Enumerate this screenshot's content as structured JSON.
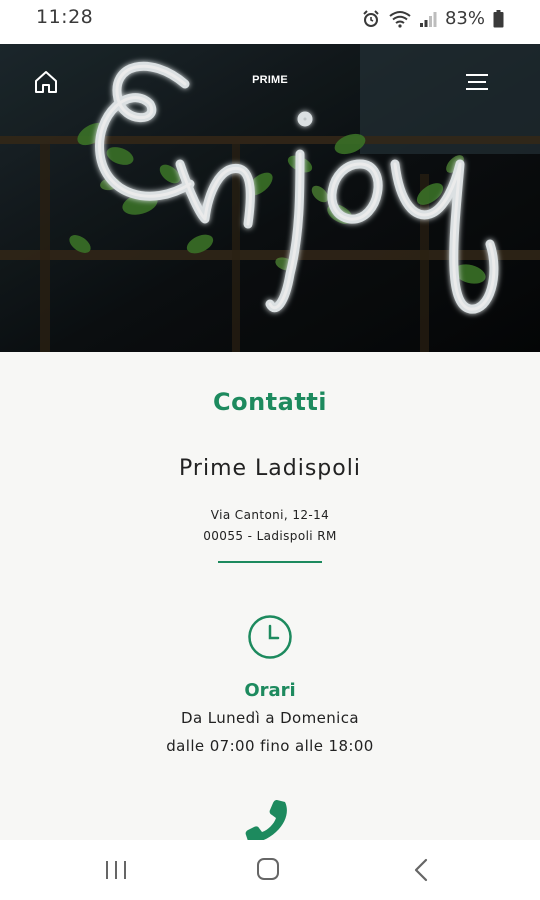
{
  "status_bar": {
    "time": "11:28",
    "battery": "83%",
    "icons": [
      "alarm-icon",
      "wifi-icon",
      "signal-icon",
      "battery-icon"
    ]
  },
  "hero": {
    "brand": "PRIME",
    "image_text": "Enjoy",
    "icons": [
      "home-icon",
      "menu-icon"
    ]
  },
  "contact": {
    "title": "Contatti",
    "venue_name": "Prime Ladispoli",
    "address_line1": "Via Cantoni, 12-14",
    "address_line2": "00055 - Ladispoli RM"
  },
  "hours": {
    "title": "Orari",
    "line1": "Da Lunedì a Domenica",
    "line2": "dalle 07:00 fino alle 18:00",
    "icon": "clock-icon"
  },
  "phone": {
    "icon": "phone-icon"
  },
  "nav_bar": {
    "icons": [
      "recents-icon",
      "home-nav-icon",
      "back-icon"
    ]
  },
  "colors": {
    "accent": "#1d8a5e",
    "background": "#f7f7f5",
    "hero_dark": "#101417"
  }
}
